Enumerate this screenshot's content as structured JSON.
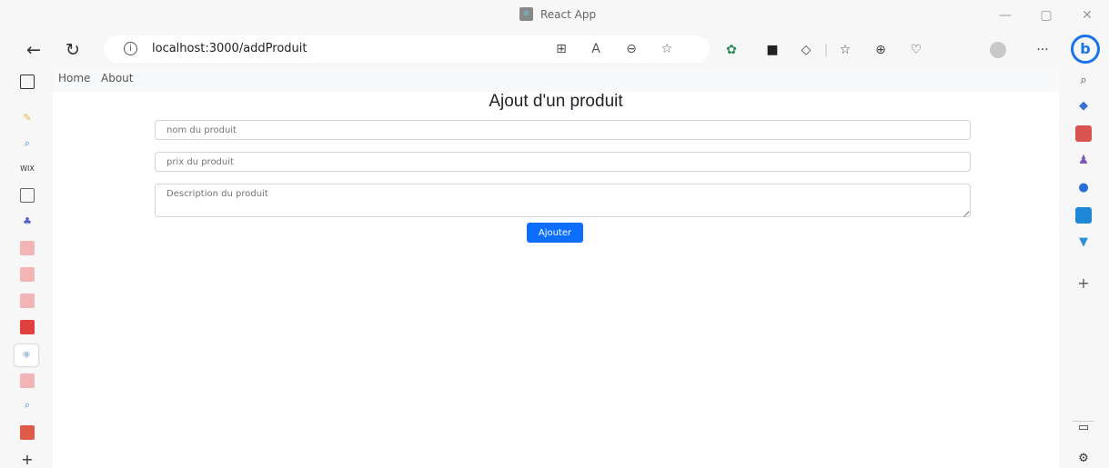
{
  "window": {
    "title": "React App",
    "minimize_icon": "—",
    "maximize_icon": "▢",
    "close_icon": "✕"
  },
  "toolbar": {
    "back_icon": "←",
    "refresh_icon": "↻",
    "info_icon": "i",
    "url": "localhost:3000/addProduit",
    "more_icon": "···",
    "bing_icon": "b"
  },
  "app": {
    "nav": {
      "home": "Home",
      "about": "About"
    },
    "form": {
      "title": "Ajout d'un produit",
      "name_placeholder": "nom du produit",
      "price_placeholder": "prix du produit",
      "description_placeholder": "Description du produit",
      "submit_label": "Ajouter"
    }
  },
  "colors": {
    "accent": "#0d6efd",
    "navbar": "#f8f9fa",
    "browser_chrome": "#f7f7f7"
  }
}
